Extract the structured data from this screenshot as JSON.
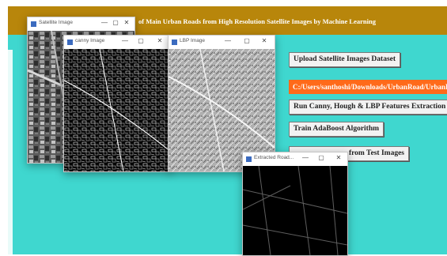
{
  "app": {
    "title": "of Main Urban Roads from High Resolution Satellite Images by Machine Learning",
    "path_text": "C:/Users/santhoshi/Downloads/UrbanRoad/UrbanRoad",
    "buttons": {
      "upload": "Upload Satellite Images Dataset",
      "features": "Run Canny, Hough & LBP Features Extraction Algorithm",
      "train": "Train AdaBoost Algorithm",
      "extract": "from Test Images"
    }
  },
  "windows": {
    "satellite": {
      "title": "Satellite Image",
      "minimize": "—",
      "maximize": "▢",
      "close": "✕"
    },
    "canny": {
      "title": "canny Image",
      "minimize": "—",
      "maximize": "▢",
      "close": "✕"
    },
    "lbp": {
      "title": "LBP Image",
      "minimize": "—",
      "maximize": "▢",
      "close": "✕"
    },
    "extracted": {
      "title": "Extracted Road...",
      "minimize": "—",
      "maximize": "▢",
      "close": "✕"
    }
  },
  "colors": {
    "background": "#3fd7cf",
    "titlebar": "#b8860b",
    "path_highlight": "#ff6a1a",
    "window_icon": "#3b6bbf"
  },
  "icons": {
    "window_icon": "app-window-icon"
  }
}
